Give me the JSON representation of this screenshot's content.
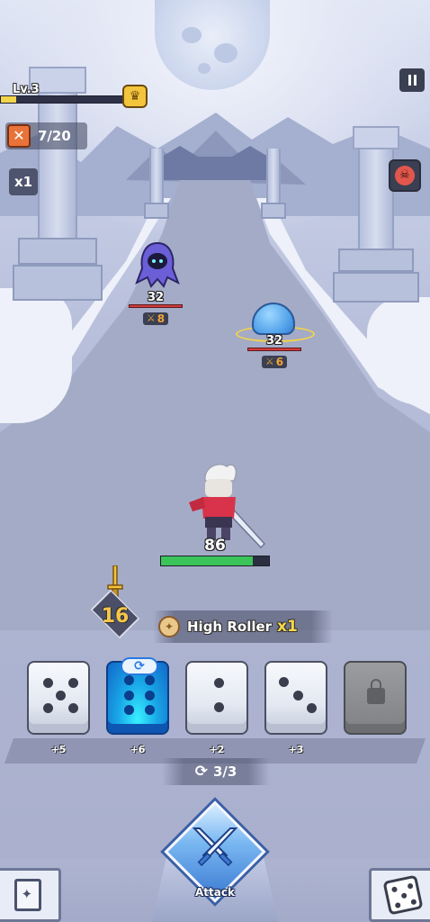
{
  "hud": {
    "level_label": "Lv.3",
    "xp_fraction": 0.12,
    "wave_counter": "7/20",
    "speed_label": "x1"
  },
  "enemies": [
    {
      "kind": "wraith",
      "hp": "32",
      "attack": "8",
      "hp_fraction": 1.0
    },
    {
      "kind": "slime",
      "hp": "32",
      "attack": "6",
      "hp_fraction": 1.0
    }
  ],
  "hero": {
    "hp": "86",
    "hp_fraction": 0.85
  },
  "attack_power": "16",
  "combo": {
    "name": "High Roller",
    "multiplier": "x1"
  },
  "dice": [
    {
      "face": 5,
      "bonus": "+5",
      "state": "normal"
    },
    {
      "face": 6,
      "bonus": "+6",
      "state": "rolled"
    },
    {
      "face": 2,
      "bonus": "+2",
      "state": "normal"
    },
    {
      "face": 3,
      "bonus": "+3",
      "state": "normal"
    },
    {
      "face": null,
      "bonus": "",
      "state": "locked"
    }
  ],
  "rerolls": "3/3",
  "buttons": {
    "attack_label": "Attack"
  },
  "icons": {
    "trophy": "trophy-icon",
    "wave": "crossed-swords-icon",
    "pause": "pause-icon",
    "boss": "skull-icon",
    "combo": "scroll-icon",
    "reroll": "refresh-icon",
    "lock": "lock-icon",
    "codex": "book-icon",
    "dice_menu": "dice-icon"
  },
  "colors": {
    "hp_green": "#3bc45a",
    "enemy_hp_red": "#d43c3c",
    "gold": "#f6c64a",
    "rolled_die": "#19a9e8"
  }
}
